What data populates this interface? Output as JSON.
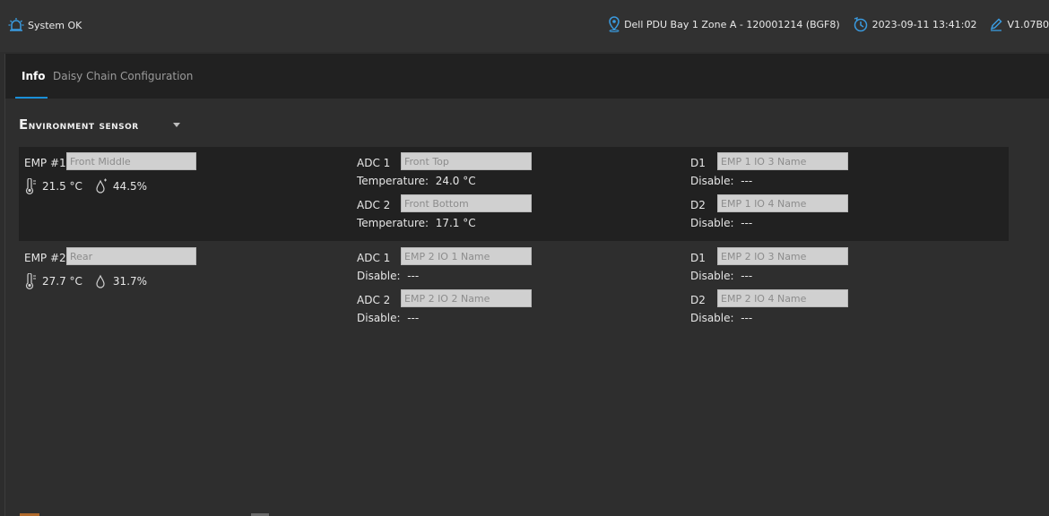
{
  "topbar": {
    "status_icon": "siren-alarm-icon",
    "status": "System OK",
    "location_icon": "location-pin-icon",
    "location": "Dell PDU Bay 1 Zone A - 120001214 (BGF8)",
    "time_icon": "clock-sync-icon",
    "datetime": "2023-09-11 13:41:02",
    "version_icon": "pencil-edit-icon",
    "version": "V1.07B0"
  },
  "tabs": [
    {
      "label": "Info",
      "active": true
    },
    {
      "label": "Daisy Chain",
      "active": false
    },
    {
      "label": "Configuration",
      "active": false
    }
  ],
  "section": {
    "title_first": "E",
    "title_rest": "nvironment sensor"
  },
  "emp1": {
    "label": "EMP #1",
    "name_placeholder": "Front Middle",
    "temperature": "21.5 °C",
    "humidity": "44.5%",
    "adc1": {
      "label": "ADC 1",
      "placeholder": "Front Top",
      "key": "Temperature:",
      "value": "24.0 °C"
    },
    "adc2": {
      "label": "ADC 2",
      "placeholder": "Front Bottom",
      "key": "Temperature:",
      "value": "17.1 °C"
    },
    "d1": {
      "label": "D1",
      "placeholder": "EMP 1 IO 3 Name",
      "key": "Disable:",
      "value": "---"
    },
    "d2": {
      "label": "D2",
      "placeholder": "EMP 1 IO 4 Name",
      "key": "Disable:",
      "value": "---"
    }
  },
  "emp2": {
    "label": "EMP #2",
    "name_placeholder": "Rear",
    "temperature": "27.7 °C",
    "humidity": "31.7%",
    "adc1": {
      "label": "ADC 1",
      "placeholder": "EMP 2 IO 1 Name",
      "key": "Disable:",
      "value": "---"
    },
    "adc2": {
      "label": "ADC 2",
      "placeholder": "EMP 2 IO 2 Name",
      "key": "Disable:",
      "value": "---"
    },
    "d1": {
      "label": "D1",
      "placeholder": "EMP 2 IO 3 Name",
      "key": "Disable:",
      "value": "---"
    },
    "d2": {
      "label": "D2",
      "placeholder": "EMP 2 IO 4 Name",
      "key": "Disable:",
      "value": "---"
    }
  },
  "colors": {
    "accent": "#1a8fd8",
    "panel": "#212121",
    "background": "#2d2d2d",
    "input": "#d0d0d0"
  }
}
